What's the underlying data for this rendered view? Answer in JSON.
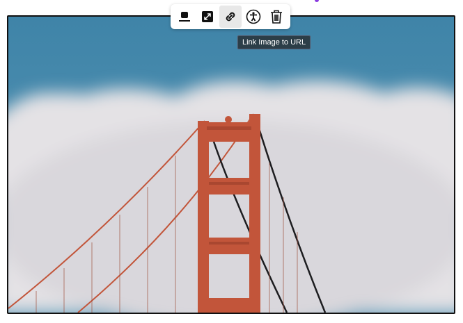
{
  "image": {
    "alt": "Golden Gate Bridge tower against clouds and blue sky"
  },
  "toolbar": {
    "items": [
      {
        "name": "align",
        "icon": "align-bottom-icon"
      },
      {
        "name": "resize",
        "icon": "expand-icon"
      },
      {
        "name": "link",
        "icon": "link-icon",
        "active": true
      },
      {
        "name": "accessibility",
        "icon": "accessibility-icon"
      },
      {
        "name": "delete",
        "icon": "trash-icon"
      }
    ]
  },
  "tooltip": {
    "text": "Link Image to URL"
  },
  "colors": {
    "sky": "#4a8aab",
    "cloud": "#e6e4e6",
    "bridge": "#c2553a"
  }
}
